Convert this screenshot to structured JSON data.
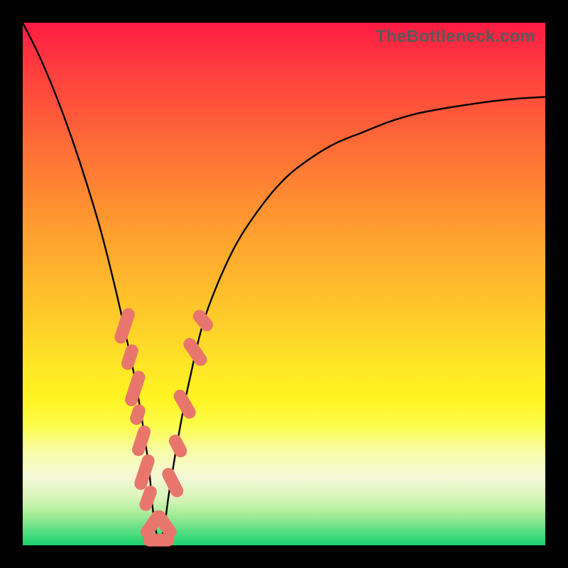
{
  "watermark": "TheBottleneck.com",
  "colors": {
    "frame": "#000000",
    "curve": "#000000",
    "marker": "#e9766d",
    "gradient_stops": [
      "#ff1a44",
      "#ff3a3f",
      "#ff5a3a",
      "#ff7a34",
      "#ff9930",
      "#ffb52c",
      "#ffd029",
      "#ffe626",
      "#fff423",
      "#fdfd4a",
      "#f8fca6",
      "#f4f8d8",
      "#d8f5b8",
      "#a7ec97",
      "#5fdf85",
      "#17d36f"
    ]
  },
  "chart_data": {
    "type": "line",
    "title": "",
    "xlabel": "",
    "ylabel": "",
    "xlim": [
      0,
      100
    ],
    "ylim": [
      0,
      100
    ],
    "grid": false,
    "legend_position": "none",
    "note": "V-shaped bottleneck curve. y≈100 means high bottleneck (red), y≈0 means optimal (green). Minimum near x≈26.",
    "series": [
      {
        "name": "bottleneck_curve",
        "x": [
          0,
          3,
          6,
          9,
          12,
          15,
          18,
          20,
          22,
          24,
          25,
          26,
          27,
          28,
          30,
          32,
          35,
          40,
          45,
          50,
          55,
          60,
          65,
          70,
          75,
          80,
          85,
          90,
          95,
          100
        ],
        "y": [
          100,
          94,
          87,
          79,
          70,
          60,
          48,
          39,
          29,
          16,
          6,
          1,
          3,
          10,
          22,
          32,
          44,
          56,
          64,
          70,
          74,
          77,
          79,
          81,
          82.5,
          83.5,
          84.3,
          85,
          85.5,
          85.8
        ]
      }
    ],
    "markers": {
      "name": "highlighted_points",
      "note": "Salmon capsule markers clustered near the curve minimum on both branches.",
      "points": [
        {
          "x": 19.5,
          "y": 42,
          "len": 3.5,
          "angle": -72
        },
        {
          "x": 20.5,
          "y": 36,
          "len": 2.5,
          "angle": -72
        },
        {
          "x": 21.5,
          "y": 30,
          "len": 3.5,
          "angle": -72
        },
        {
          "x": 22.0,
          "y": 25,
          "len": 2.0,
          "angle": -72
        },
        {
          "x": 22.7,
          "y": 20,
          "len": 3.0,
          "angle": -72
        },
        {
          "x": 23.3,
          "y": 14,
          "len": 3.5,
          "angle": -72
        },
        {
          "x": 24.0,
          "y": 9,
          "len": 2.5,
          "angle": -70
        },
        {
          "x": 24.8,
          "y": 4,
          "len": 3.0,
          "angle": -55
        },
        {
          "x": 26.0,
          "y": 1,
          "len": 3.0,
          "angle": 0
        },
        {
          "x": 27.2,
          "y": 4,
          "len": 3.0,
          "angle": 55
        },
        {
          "x": 28.7,
          "y": 12,
          "len": 3.0,
          "angle": 63
        },
        {
          "x": 29.7,
          "y": 19,
          "len": 2.3,
          "angle": 62
        },
        {
          "x": 31.0,
          "y": 27,
          "len": 3.0,
          "angle": 60
        },
        {
          "x": 33.0,
          "y": 37,
          "len": 3.0,
          "angle": 55
        },
        {
          "x": 34.5,
          "y": 43,
          "len": 2.3,
          "angle": 50
        }
      ]
    }
  }
}
